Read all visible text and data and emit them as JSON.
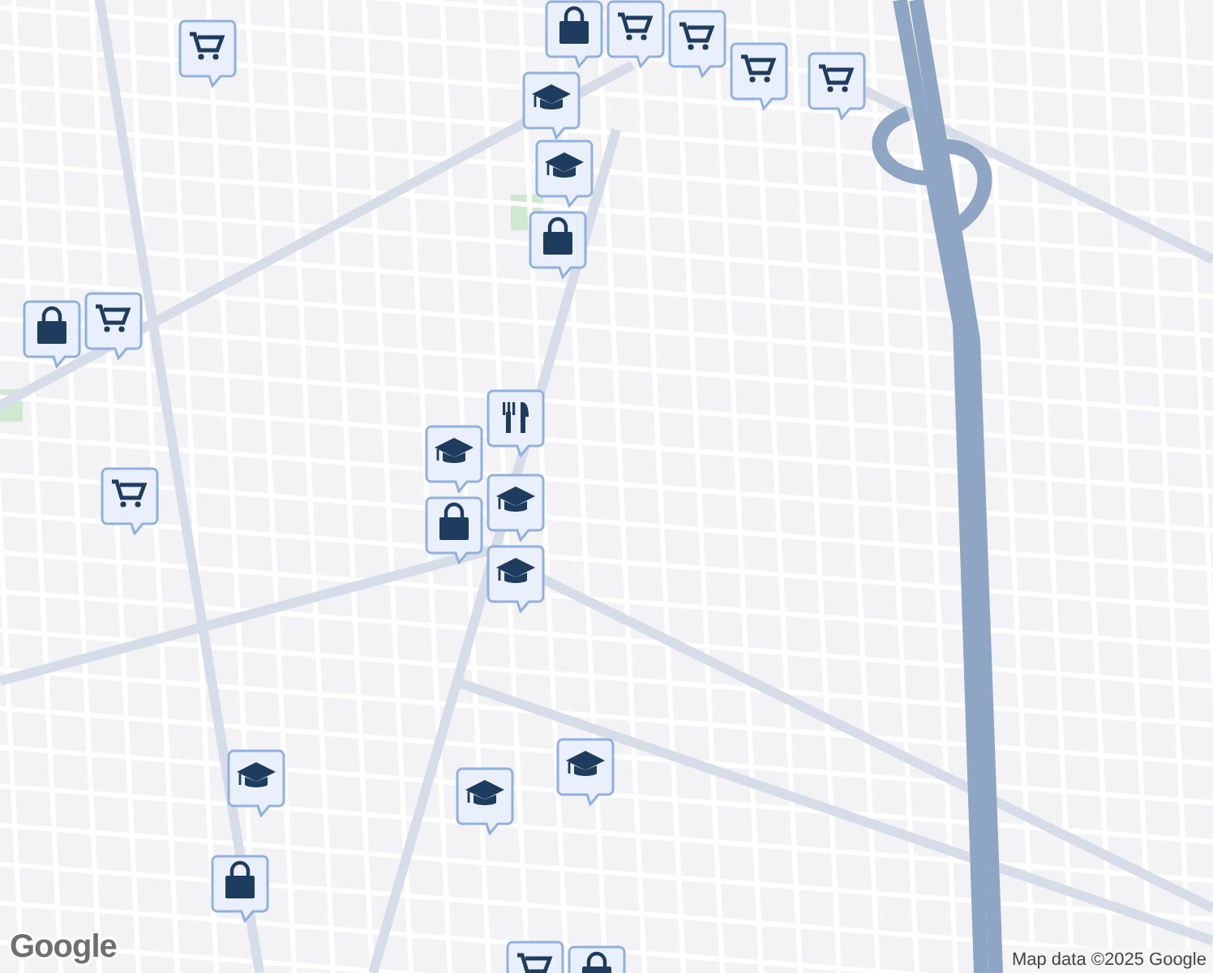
{
  "map": {
    "pins": [
      {
        "kind": "cart"
      },
      {
        "kind": "bag"
      },
      {
        "kind": "cart"
      },
      {
        "kind": "cart"
      },
      {
        "kind": "cart"
      },
      {
        "kind": "cart"
      },
      {
        "kind": "school"
      },
      {
        "kind": "school"
      },
      {
        "kind": "bag"
      },
      {
        "kind": "bag"
      },
      {
        "kind": "cart"
      },
      {
        "kind": "restaurant"
      },
      {
        "kind": "school"
      },
      {
        "kind": "cart"
      },
      {
        "kind": "school"
      },
      {
        "kind": "bag"
      },
      {
        "kind": "school"
      },
      {
        "kind": "school"
      },
      {
        "kind": "school"
      },
      {
        "kind": "school"
      },
      {
        "kind": "bag"
      },
      {
        "kind": "cart"
      },
      {
        "kind": "bag"
      }
    ]
  },
  "logo": "Google",
  "attribution": "Map data ©2025 Google"
}
